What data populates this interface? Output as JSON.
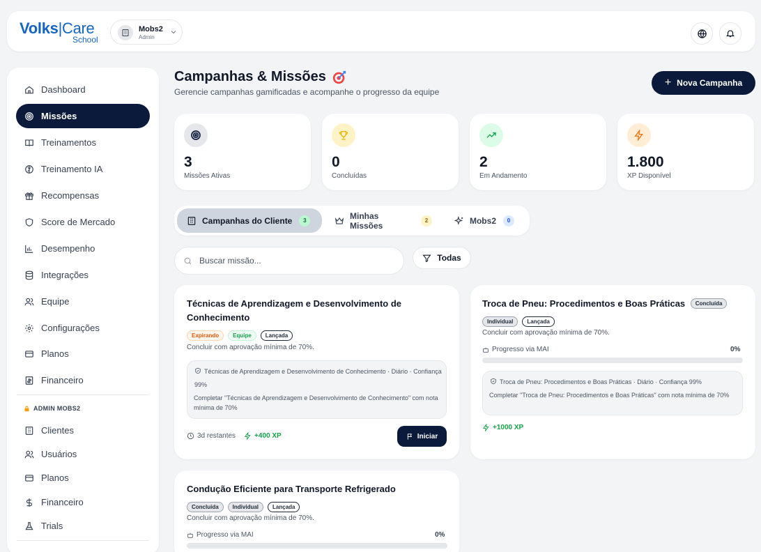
{
  "brand": {
    "name_bold": "Volks",
    "name_light": "Care",
    "sub": "School",
    "color": "#1565c0"
  },
  "org": {
    "name": "Mobs2",
    "role": "Admin"
  },
  "sidebar": {
    "items": [
      {
        "label": "Dashboard",
        "icon": "home-icon"
      },
      {
        "label": "Missões",
        "icon": "target-icon",
        "active": true
      },
      {
        "label": "Treinamentos",
        "icon": "book-icon"
      },
      {
        "label": "Treinamento IA",
        "icon": "brain-icon"
      },
      {
        "label": "Recompensas",
        "icon": "gift-icon"
      },
      {
        "label": "Score de Mercado",
        "icon": "shield-icon"
      },
      {
        "label": "Desempenho",
        "icon": "bar-chart-icon"
      },
      {
        "label": "Integrações",
        "icon": "database-icon"
      },
      {
        "label": "Equipe",
        "icon": "users-icon"
      },
      {
        "label": "Configurações",
        "icon": "gear-icon"
      },
      {
        "label": "Planos",
        "icon": "card-icon"
      },
      {
        "label": "Financeiro",
        "icon": "receipt-icon"
      }
    ],
    "admin_section": "ADMIN MOBS2",
    "admin_items": [
      {
        "label": "Clientes",
        "icon": "building-icon"
      },
      {
        "label": "Usuários",
        "icon": "users-icon"
      },
      {
        "label": "Planos",
        "icon": "card-icon"
      },
      {
        "label": "Financeiro",
        "icon": "dollar-icon"
      },
      {
        "label": "Trials",
        "icon": "flask-icon"
      }
    ]
  },
  "header": {
    "title": "Campanhas & Missões",
    "subtitle": "Gerencie campanhas gamificadas e acompanhe o progresso da equipe",
    "new_button": "Nova Campanha"
  },
  "stats": [
    {
      "value": "3",
      "label": "Missões Ativas",
      "icon": "target-icon",
      "bg": "#e5e7eb"
    },
    {
      "value": "0",
      "label": "Concluídas",
      "icon": "trophy-icon",
      "bg": "#fef3c7"
    },
    {
      "value": "2",
      "label": "Em Andamento",
      "icon": "trending-up-icon",
      "bg": "#dcfce7"
    },
    {
      "value": "1.800",
      "label": "XP Disponível",
      "icon": "zap-icon",
      "bg": "#ffedd5"
    }
  ],
  "tabs": [
    {
      "label": "Campanhas do Cliente",
      "count": "3",
      "active": true
    },
    {
      "label": "Minhas Missões",
      "count": "2"
    },
    {
      "label": "Mobs2",
      "count": "0"
    }
  ],
  "search": {
    "placeholder": "Buscar missão..."
  },
  "filter": {
    "label": "Todas"
  },
  "missions": [
    {
      "title": "Técnicas de Aprendizagem e Desenvolvimento de Conhecimento",
      "badges": [
        "Expirando",
        "Equipe",
        "Lançada"
      ],
      "desc": "Concluir com aprovação mínima de 70%.",
      "info_title": "Técnicas de Aprendizagem e Desenvolvimento de Conhecimento",
      "info_freq": "Diário",
      "info_conf": "Confiança 99%",
      "info_desc": "Completar \"Técnicas de Aprendizagem e Desenvolvimento de Conhecimento\" com nota mínima de 70%",
      "remaining": "3d restantes",
      "xp": "+400 XP",
      "action": "Iniciar"
    },
    {
      "title": "Troca de Pneu: Procedimentos e Boas Práticas",
      "status": "Concluída",
      "badges": [
        "Individual",
        "Lançada"
      ],
      "desc": "Concluir com aprovação mínima de 70%.",
      "progress_label": "Progresso via MAI",
      "progress_pct": "0%",
      "progress": 0,
      "info_title": "Troca de Pneu: Procedimentos e Boas Práticas",
      "info_freq": "Diário",
      "info_conf": "Confiança 99%",
      "info_desc": "Completar \"Troca de Pneu: Procedimentos e Boas Práticas\" com nota mínima de 70%",
      "xp": "+1000 XP"
    },
    {
      "title": "Condução Eficiente para Transporte Refrigerado",
      "badges": [
        "Concluída",
        "Individual",
        "Lançada"
      ],
      "desc": "Concluir com aprovação mínima de 70%.",
      "progress_label": "Progresso via MAI",
      "progress_pct": "0%",
      "progress": 0
    }
  ]
}
